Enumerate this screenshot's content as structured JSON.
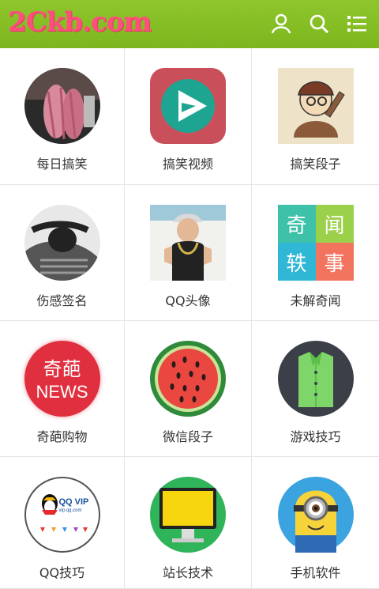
{
  "header": {
    "logo": "2Ckb.com",
    "icons": [
      "user-icon",
      "search-icon",
      "menu-icon"
    ],
    "bg_color": "#82bb22"
  },
  "grid": {
    "items": [
      {
        "label": "每日搞笑",
        "icon": "photo-pink-sweater"
      },
      {
        "label": "搞笑视频",
        "icon": "play-triangle-icon"
      },
      {
        "label": "搞笑段子",
        "icon": "cartoon-salute"
      },
      {
        "label": "伤感签名",
        "icon": "photo-bw-woman"
      },
      {
        "label": "QQ头像",
        "icon": "photo-boy-hat"
      },
      {
        "label": "未解奇闻",
        "icon": "tiles-text",
        "tiles": [
          "奇",
          "闻",
          "轶",
          "事"
        ]
      },
      {
        "label": "奇葩购物",
        "icon": "news-badge",
        "badge_top": "奇葩",
        "badge_bottom": "NEWS"
      },
      {
        "label": "微信段子",
        "icon": "watermelon-icon"
      },
      {
        "label": "游戏技巧",
        "icon": "shirt-icon"
      },
      {
        "label": "QQ技巧",
        "icon": "qq-vip-logo",
        "badge_text": "QQ VIP",
        "badge_sub": "vip.qq.com"
      },
      {
        "label": "站长技术",
        "icon": "monitor-icon"
      },
      {
        "label": "手机软件",
        "icon": "minion-icon"
      }
    ]
  }
}
